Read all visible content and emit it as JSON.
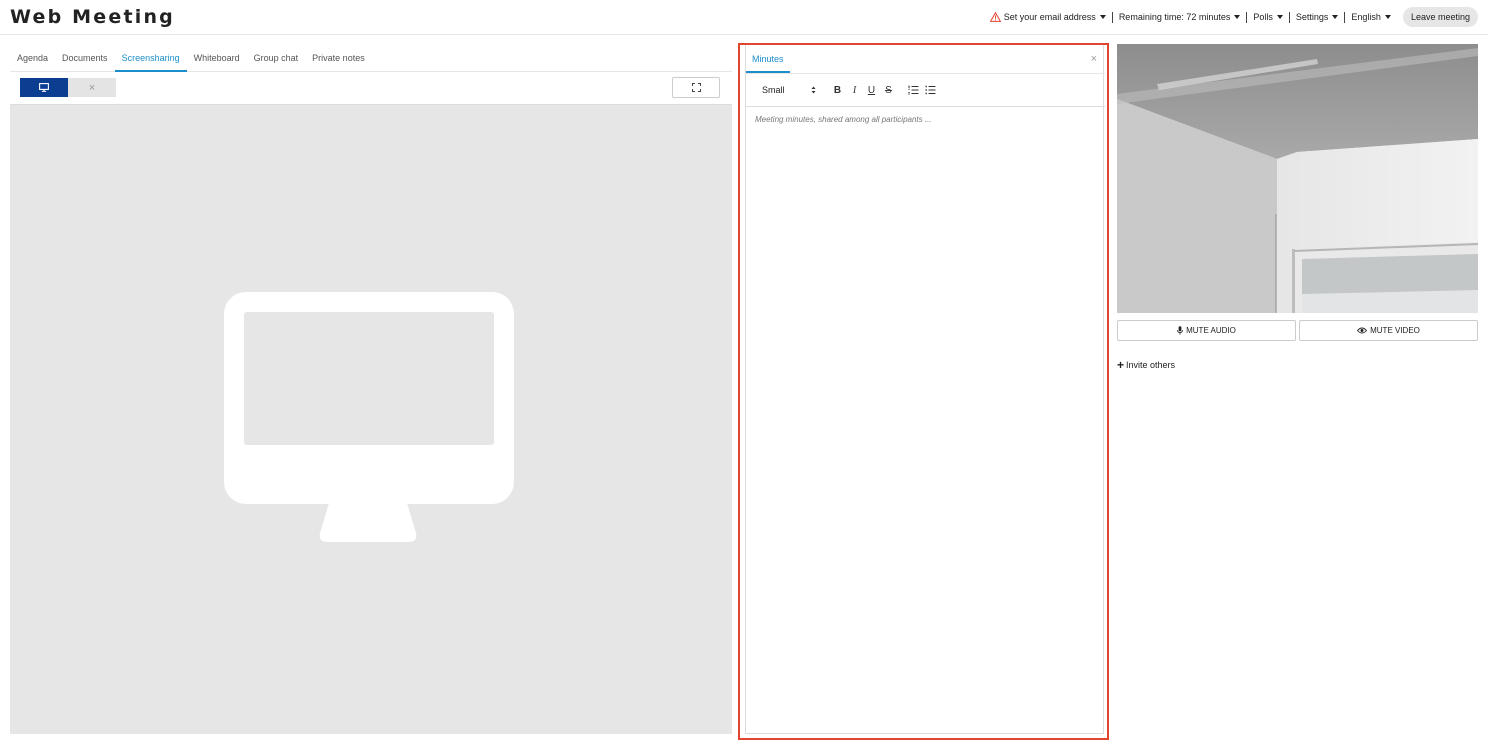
{
  "app": {
    "title": "Web Meeting"
  },
  "topnav": {
    "email": "Set your email address",
    "remaining": "Remaining time: 72 minutes",
    "polls": "Polls",
    "settings": "Settings",
    "language": "English",
    "leave": "Leave meeting"
  },
  "tabs": [
    "Agenda",
    "Documents",
    "Screensharing",
    "Whiteboard",
    "Group chat",
    "Private notes"
  ],
  "active_tab": "Screensharing",
  "screenshare": {
    "stop_glyph": "×"
  },
  "minutes": {
    "tab": "Minutes",
    "close": "×",
    "size": "Small",
    "bold": "B",
    "italic": "I",
    "underline": "U",
    "strike": "S",
    "placeholder": "Meeting minutes, shared among all participants ..."
  },
  "media": {
    "mute_audio": "MUTE AUDIO",
    "mute_video": "MUTE VIDEO"
  },
  "invite": "Invite others",
  "colors": {
    "accent": "#1a8fc9",
    "share_button": "#0b3d91",
    "highlight_border": "#e2452e",
    "warning": "#e2452e"
  },
  "icons": [
    "warning-icon",
    "monitor-icon",
    "close-icon",
    "fullscreen-icon",
    "ordered-list-icon",
    "bullet-list-icon",
    "microphone-icon",
    "eye-icon",
    "plus-icon"
  ]
}
